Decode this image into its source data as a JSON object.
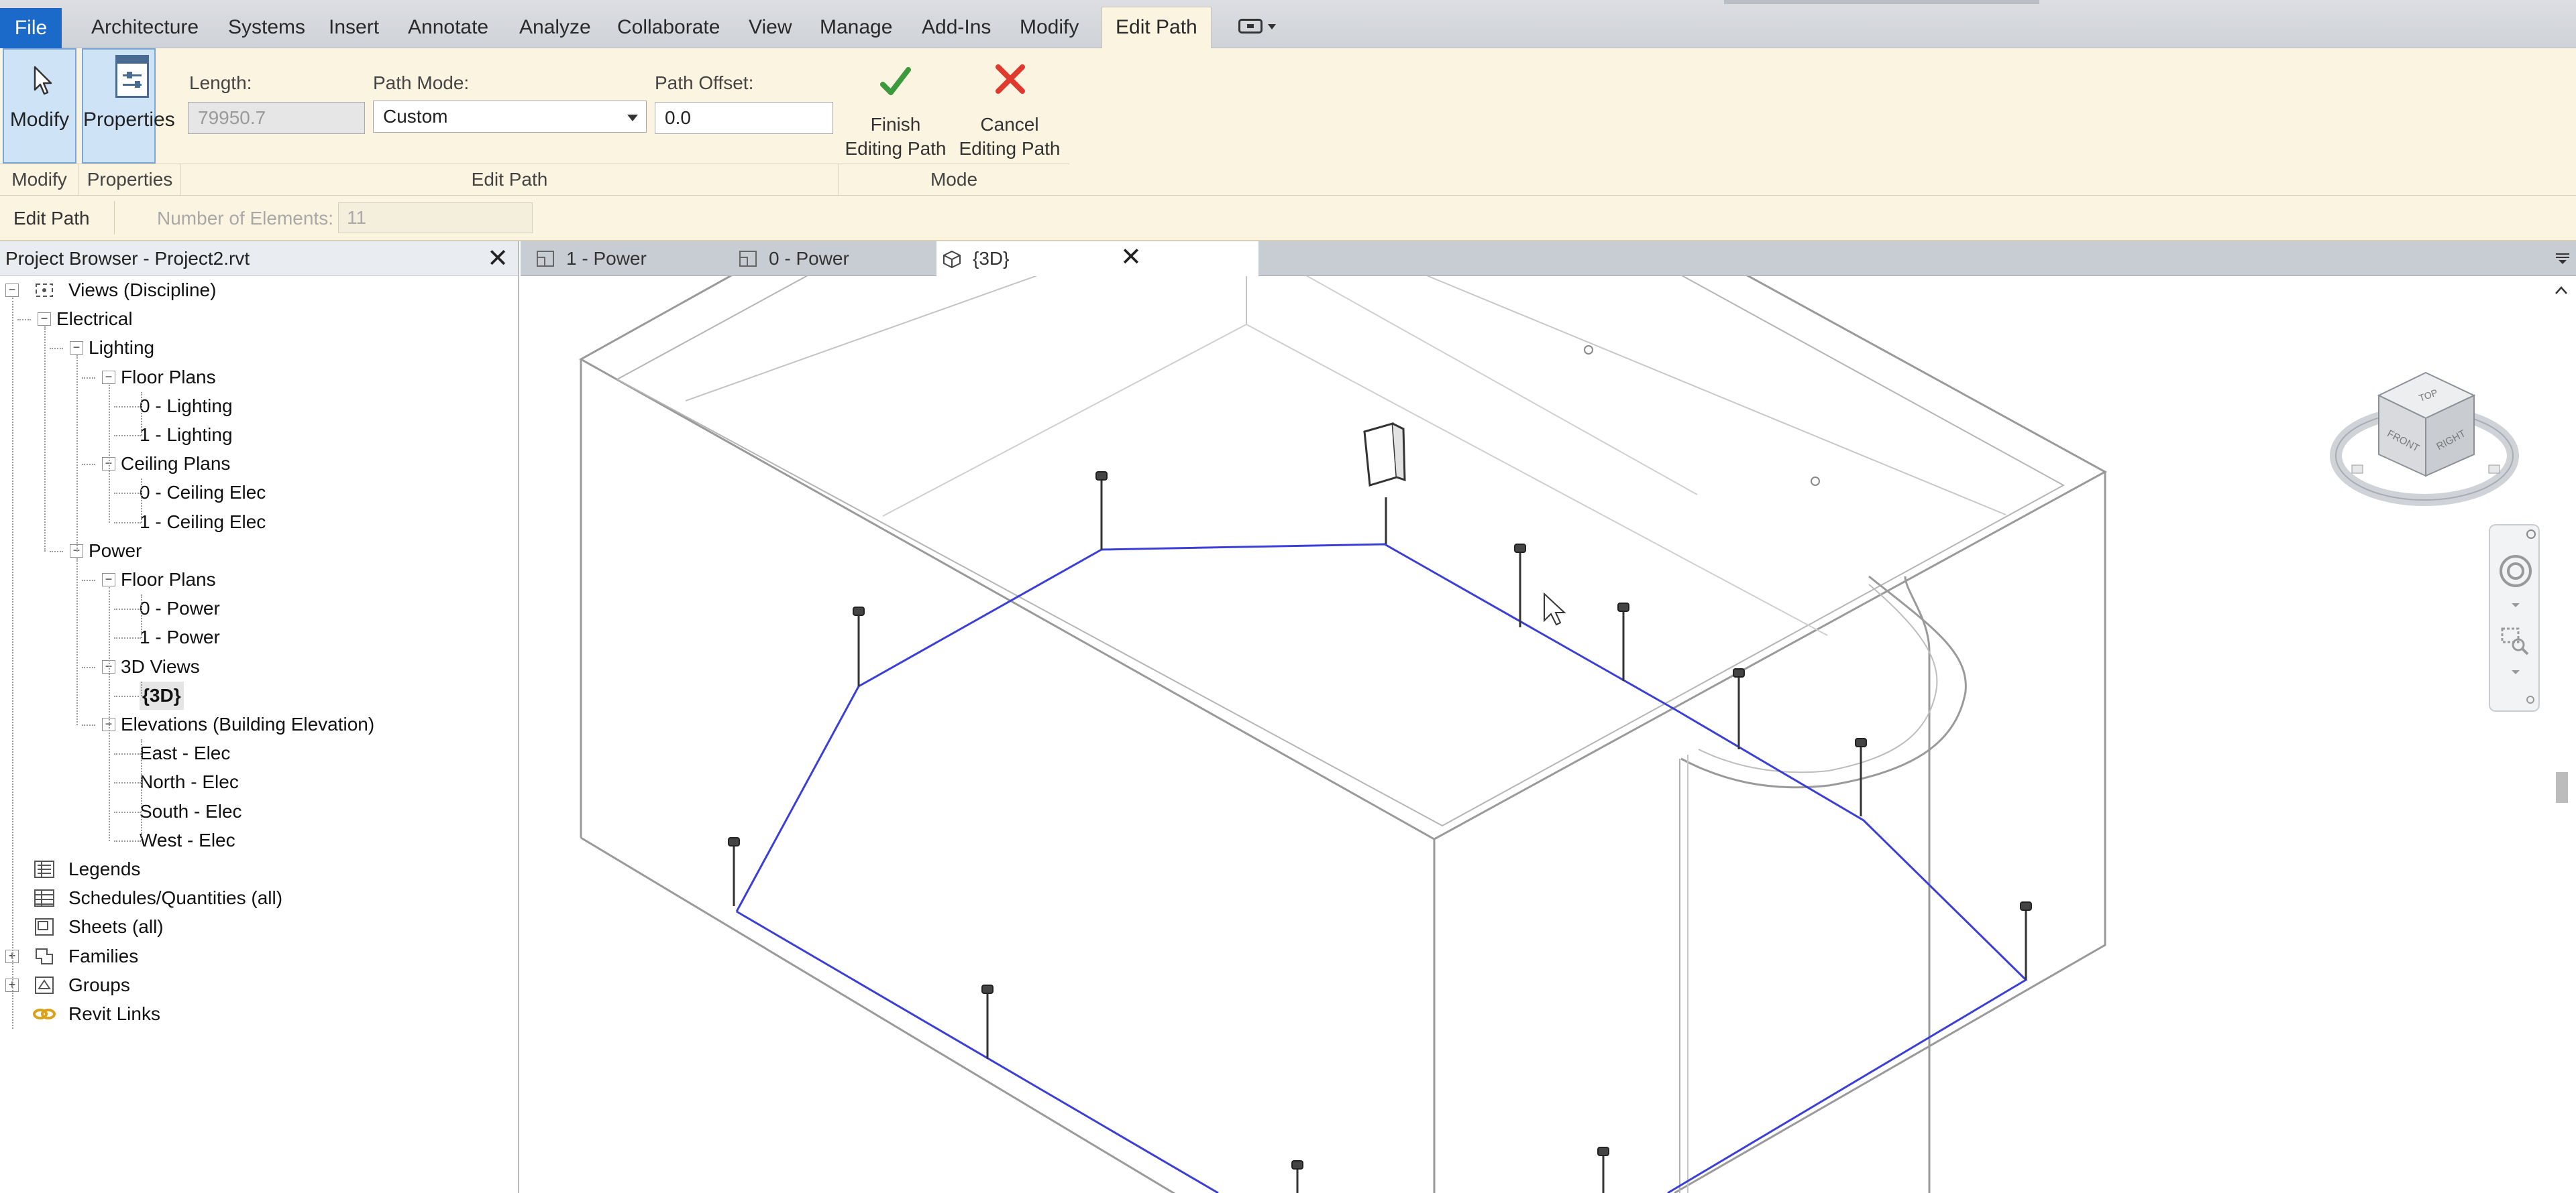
{
  "ribbon_tabs": [
    "File",
    "Architecture",
    "Systems",
    "Insert",
    "Annotate",
    "Analyze",
    "Collaborate",
    "View",
    "Manage",
    "Add-Ins",
    "Modify",
    "Edit Path"
  ],
  "active_tab": "Edit Path",
  "ribbon": {
    "modify_label": "Modify",
    "properties_label": "Properties",
    "length_label": "Length:",
    "length_value": "79950.7",
    "path_mode_label": "Path Mode:",
    "path_mode_value": "Custom",
    "path_offset_label": "Path Offset:",
    "path_offset_value": "0.0",
    "finish_label_1": "Finish",
    "finish_label_2": "Editing Path",
    "cancel_label_1": "Cancel",
    "cancel_label_2": "Editing Path",
    "panels": {
      "modify": "Modify",
      "properties": "Properties",
      "edit_path": "Edit Path",
      "mode": "Mode"
    }
  },
  "options_bar": {
    "mode_label": "Edit Path",
    "elements_label": "Number of Elements:",
    "elements_value": "11"
  },
  "browser": {
    "title": "Project Browser - Project2.rvt",
    "items": [
      {
        "label": "Views (Discipline)",
        "level": 0,
        "expander": "minus",
        "icon": "views-icon"
      },
      {
        "label": "Electrical",
        "level": 1,
        "expander": "minus"
      },
      {
        "label": "Lighting",
        "level": 2,
        "expander": "minus"
      },
      {
        "label": "Floor Plans",
        "level": 3,
        "expander": "minus"
      },
      {
        "label": "0 - Lighting",
        "level": 4
      },
      {
        "label": "1 - Lighting",
        "level": 4
      },
      {
        "label": "Ceiling Plans",
        "level": 3,
        "expander": "minus"
      },
      {
        "label": "0 - Ceiling Elec",
        "level": 4
      },
      {
        "label": "1 - Ceiling Elec",
        "level": 4
      },
      {
        "label": "Power",
        "level": 2,
        "expander": "minus"
      },
      {
        "label": "Floor Plans",
        "level": 3,
        "expander": "minus"
      },
      {
        "label": "0 - Power",
        "level": 4
      },
      {
        "label": "1 - Power",
        "level": 4
      },
      {
        "label": "3D Views",
        "level": 3,
        "expander": "minus"
      },
      {
        "label": "{3D}",
        "level": 4,
        "selected": true
      },
      {
        "label": "Elevations (Building Elevation)",
        "level": 3,
        "expander": "minus"
      },
      {
        "label": "East - Elec",
        "level": 4
      },
      {
        "label": "North - Elec",
        "level": 4
      },
      {
        "label": "South - Elec",
        "level": 4
      },
      {
        "label": "West - Elec",
        "level": 4
      },
      {
        "label": "Legends",
        "level": 0,
        "icon": "legends-icon"
      },
      {
        "label": "Schedules/Quantities (all)",
        "level": 0,
        "icon": "schedules-icon"
      },
      {
        "label": "Sheets (all)",
        "level": 0,
        "icon": "sheets-icon"
      },
      {
        "label": "Families",
        "level": 0,
        "expander": "plus",
        "icon": "families-icon"
      },
      {
        "label": "Groups",
        "level": 0,
        "expander": "plus",
        "icon": "groups-icon"
      },
      {
        "label": "Revit Links",
        "level": 0,
        "icon": "revit-links-icon"
      }
    ]
  },
  "view_tabs": [
    {
      "label": "1 - Power",
      "icon": "floor-plan-icon"
    },
    {
      "label": "0 - Power",
      "icon": "floor-plan-icon"
    },
    {
      "label": "{3D}",
      "icon": "3d-view-icon",
      "active": true
    }
  ],
  "viewcube": {
    "top": "TOP",
    "front": "FRONT",
    "right": "RIGHT"
  },
  "colors": {
    "accent": "#1b6ac9",
    "ribbon_bg": "#fbf4e0",
    "path": "#3b3fd8",
    "model_lines": "#8a8a8a"
  }
}
